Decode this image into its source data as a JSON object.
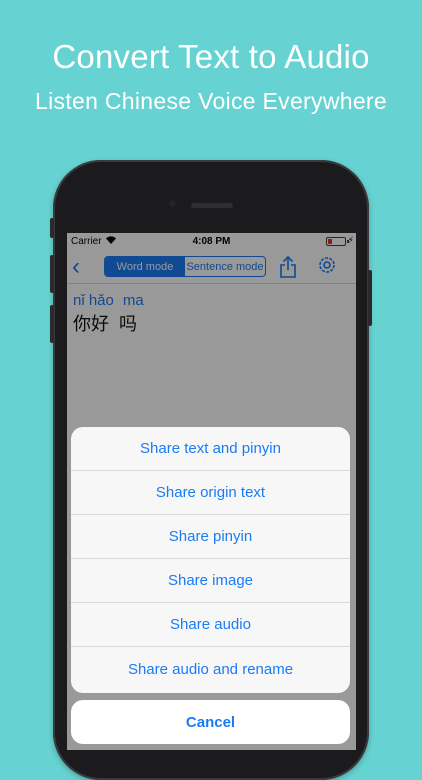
{
  "promo": {
    "headline": "Convert Text to Audio",
    "subheadline": "Listen Chinese Voice Everywhere"
  },
  "status_bar": {
    "carrier": "Carrier",
    "time": "4:08 PM",
    "wifi_icon": "wifi-icon",
    "battery_icon": "battery-icon",
    "battery_level_percent": 15
  },
  "nav": {
    "back_icon": "chevron-left-icon",
    "segments": [
      "Word mode",
      "Sentence mode"
    ],
    "selected_segment": "Word mode",
    "share_icon": "share-icon",
    "settings_icon": "gear-icon"
  },
  "content": {
    "pinyin": [
      "nǐ hǎo",
      "ma"
    ],
    "hanzi": [
      "你好",
      "吗"
    ]
  },
  "action_sheet": {
    "items": [
      "Share text and pinyin",
      "Share origin text",
      "Share pinyin",
      "Share image",
      "Share audio",
      "Share audio and rename"
    ],
    "cancel": "Cancel"
  },
  "colors": {
    "background": "#66d3d2",
    "accent": "#1a7cf5",
    "phone_body": "#1b1b1d"
  }
}
